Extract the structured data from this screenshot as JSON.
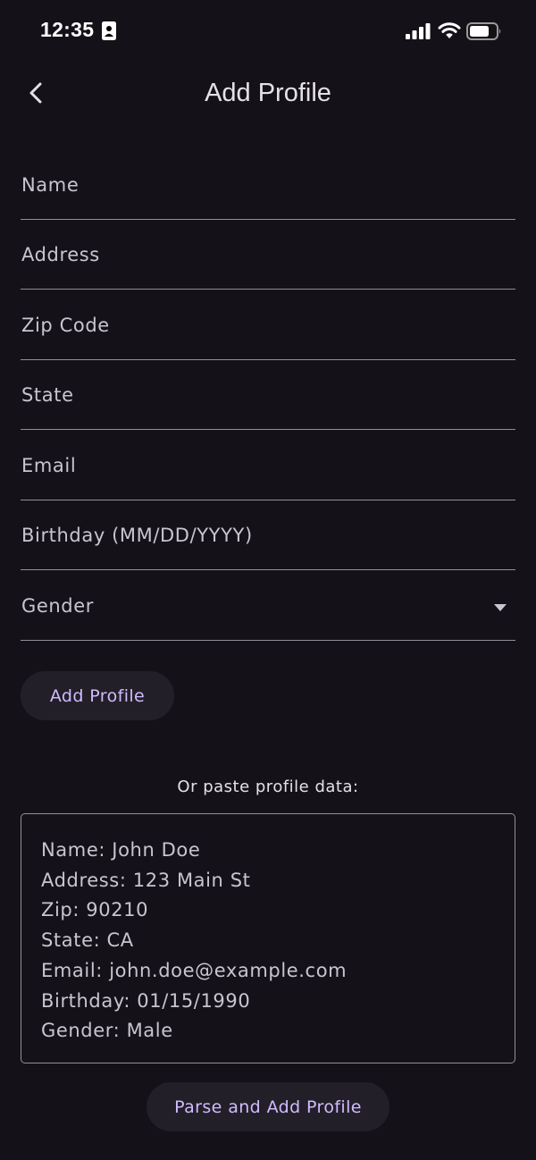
{
  "status_bar": {
    "time": "12:35",
    "icons": [
      "id-card-icon",
      "signal-icon",
      "wifi-icon",
      "battery-icon"
    ]
  },
  "app_bar": {
    "back_icon": "chevron-left-icon",
    "title": "Add Profile"
  },
  "form": {
    "fields": [
      {
        "label": "Name",
        "value": ""
      },
      {
        "label": "Address",
        "value": ""
      },
      {
        "label": "Zip Code",
        "value": ""
      },
      {
        "label": "State",
        "value": ""
      },
      {
        "label": "Email",
        "value": ""
      },
      {
        "label": "Birthday (MM/DD/YYYY)",
        "value": ""
      },
      {
        "label": "Gender",
        "value": "",
        "type": "dropdown",
        "icon": "dropdown-arrow-icon"
      }
    ],
    "submit_label": "Add Profile"
  },
  "paste": {
    "label": "Or paste profile data:",
    "lines": [
      "Name: John Doe",
      "Address: 123 Main St",
      "Zip: 90210",
      "State: CA",
      "Email: john.doe@example.com",
      "Birthday: 01/15/1990",
      "Gender: Male"
    ],
    "parse_label": "Parse and Add Profile"
  },
  "colors": {
    "background": "#141218",
    "text": "#e6e0e9",
    "label": "#cac4d0",
    "outline": "#938f99",
    "button_bg": "#231f28",
    "accent": "#d0bcff"
  }
}
